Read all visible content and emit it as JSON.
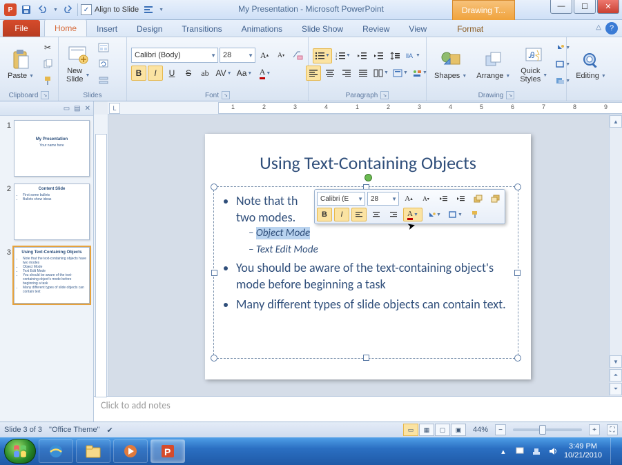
{
  "app": {
    "title": "My Presentation  -  Microsoft PowerPoint",
    "context_tab_group": "Drawing T..."
  },
  "qat": {
    "align_to_slide": "Align to Slide"
  },
  "tabs": {
    "file": "File",
    "home": "Home",
    "insert": "Insert",
    "design": "Design",
    "transitions": "Transitions",
    "animations": "Animations",
    "slideshow": "Slide Show",
    "review": "Review",
    "view": "View",
    "format": "Format"
  },
  "ribbon": {
    "clipboard": {
      "label": "Clipboard",
      "paste": "Paste"
    },
    "slides": {
      "label": "Slides",
      "new_slide": "New\nSlide"
    },
    "font": {
      "label": "Font",
      "family": "Calibri (Body)",
      "size": "28"
    },
    "paragraph": {
      "label": "Paragraph"
    },
    "drawing": {
      "label": "Drawing",
      "shapes": "Shapes",
      "arrange": "Arrange",
      "quick_styles": "Quick\nStyles"
    },
    "editing": {
      "label": "Editing",
      "btn": "Editing"
    }
  },
  "thumbnails": [
    {
      "n": "1",
      "title": "My Presentation",
      "lines": [
        "Your name here"
      ]
    },
    {
      "n": "2",
      "title": "Content Slide",
      "lines": [
        "First some bullets",
        "Bullets show ideas"
      ]
    },
    {
      "n": "3",
      "title": "Using Text-Containing Objects",
      "lines": [
        "Note that the text-containing objects have two modes",
        "Object Mode",
        "Text Edit Mode",
        "You should be aware of the text-containing object's mode before beginning a task",
        "Many different types of slide objects can contain text"
      ]
    }
  ],
  "slide": {
    "title": "Using Text-Containing Objects",
    "bullets": [
      {
        "text_a": "Note that th",
        "text_b": "two modes."
      },
      {
        "text": "You should be aware of the text-containing object's mode before beginning a task"
      },
      {
        "text": "Many different types of slide objects can contain text."
      }
    ],
    "sub": [
      "Object Mode",
      "Text Edit Mode"
    ]
  },
  "mini_toolbar": {
    "font": "Calibri (E",
    "size": "28"
  },
  "notes_placeholder": "Click to add notes",
  "status": {
    "slide": "Slide 3 of 3",
    "theme": "\"Office Theme\"",
    "zoom": "44%"
  },
  "clock": {
    "time": "3:49 PM",
    "date": "10/21/2010"
  },
  "ruler_nums": [
    "1",
    "2",
    "3",
    "4",
    "1",
    "2",
    "3",
    "4",
    "5",
    "6",
    "7",
    "8",
    "9"
  ]
}
